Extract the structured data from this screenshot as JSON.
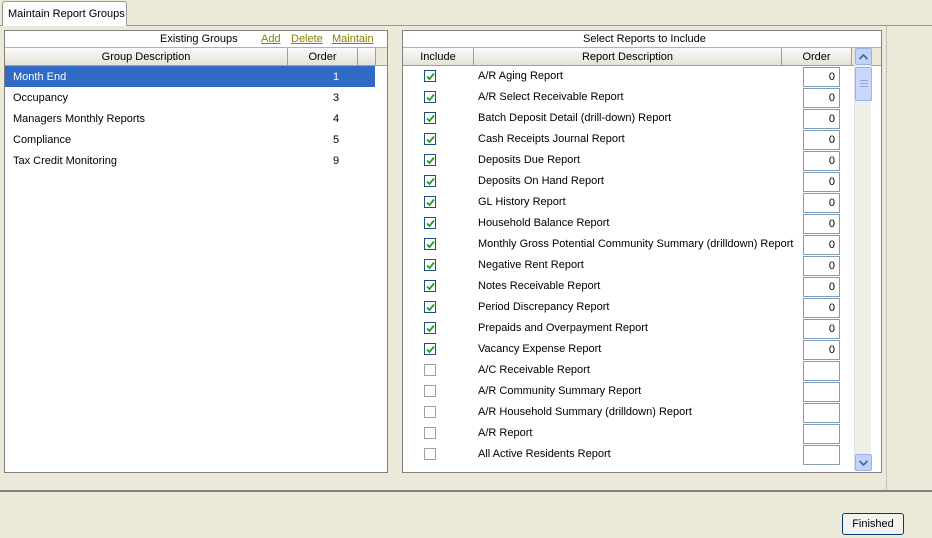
{
  "tab": {
    "label": "Maintain Report Groups"
  },
  "groups_panel": {
    "caption": "Existing Groups",
    "add_label": "Add",
    "delete_label": "Delete",
    "maintain_label": "Maintain",
    "columns": {
      "description": "Group Description",
      "order": "Order"
    },
    "rows": [
      {
        "description": "Month End",
        "order": "1",
        "selected": true
      },
      {
        "description": "Occupancy",
        "order": "3"
      },
      {
        "description": "Managers Monthly Reports",
        "order": "4"
      },
      {
        "description": "Compliance",
        "order": "5"
      },
      {
        "description": "Tax Credit Monitoring",
        "order": "9"
      }
    ]
  },
  "reports_panel": {
    "caption": "Select Reports to Include",
    "columns": {
      "include": "Include",
      "description": "Report Description",
      "order": "Order"
    },
    "rows": [
      {
        "checked": true,
        "description": "A/R Aging Report",
        "order": "0"
      },
      {
        "checked": true,
        "description": "A/R Select Receivable Report",
        "order": "0"
      },
      {
        "checked": true,
        "description": "Batch Deposit Detail (drill-down) Report",
        "order": "0"
      },
      {
        "checked": true,
        "description": "Cash Receipts Journal Report",
        "order": "0"
      },
      {
        "checked": true,
        "description": "Deposits Due Report",
        "order": "0"
      },
      {
        "checked": true,
        "description": "Deposits On Hand Report",
        "order": "0"
      },
      {
        "checked": true,
        "description": "GL History Report",
        "order": "0"
      },
      {
        "checked": true,
        "description": "Household Balance Report",
        "order": "0"
      },
      {
        "checked": true,
        "description": "Monthly Gross Potential Community Summary (drilldown) Report",
        "order": "0"
      },
      {
        "checked": true,
        "description": "Negative Rent Report",
        "order": "0"
      },
      {
        "checked": true,
        "description": "Notes Receivable Report",
        "order": "0"
      },
      {
        "checked": true,
        "description": "Period Discrepancy Report",
        "order": "0"
      },
      {
        "checked": true,
        "description": "Prepaids and Overpayment Report",
        "order": "0"
      },
      {
        "checked": true,
        "description": "Vacancy Expense Report",
        "order": "0"
      },
      {
        "checked": false,
        "description": "A/C Receivable Report",
        "order": ""
      },
      {
        "checked": false,
        "description": "A/R Community Summary Report",
        "order": ""
      },
      {
        "checked": false,
        "description": "A/R Household Summary (drilldown) Report",
        "order": ""
      },
      {
        "checked": false,
        "description": "A/R Report",
        "order": ""
      },
      {
        "checked": false,
        "description": "All Active Residents Report",
        "order": ""
      }
    ]
  },
  "footer": {
    "finished_label": "Finished"
  },
  "colors": {
    "selection": "#316ac5",
    "link": "#8b8000",
    "background": "#ece9d8"
  }
}
